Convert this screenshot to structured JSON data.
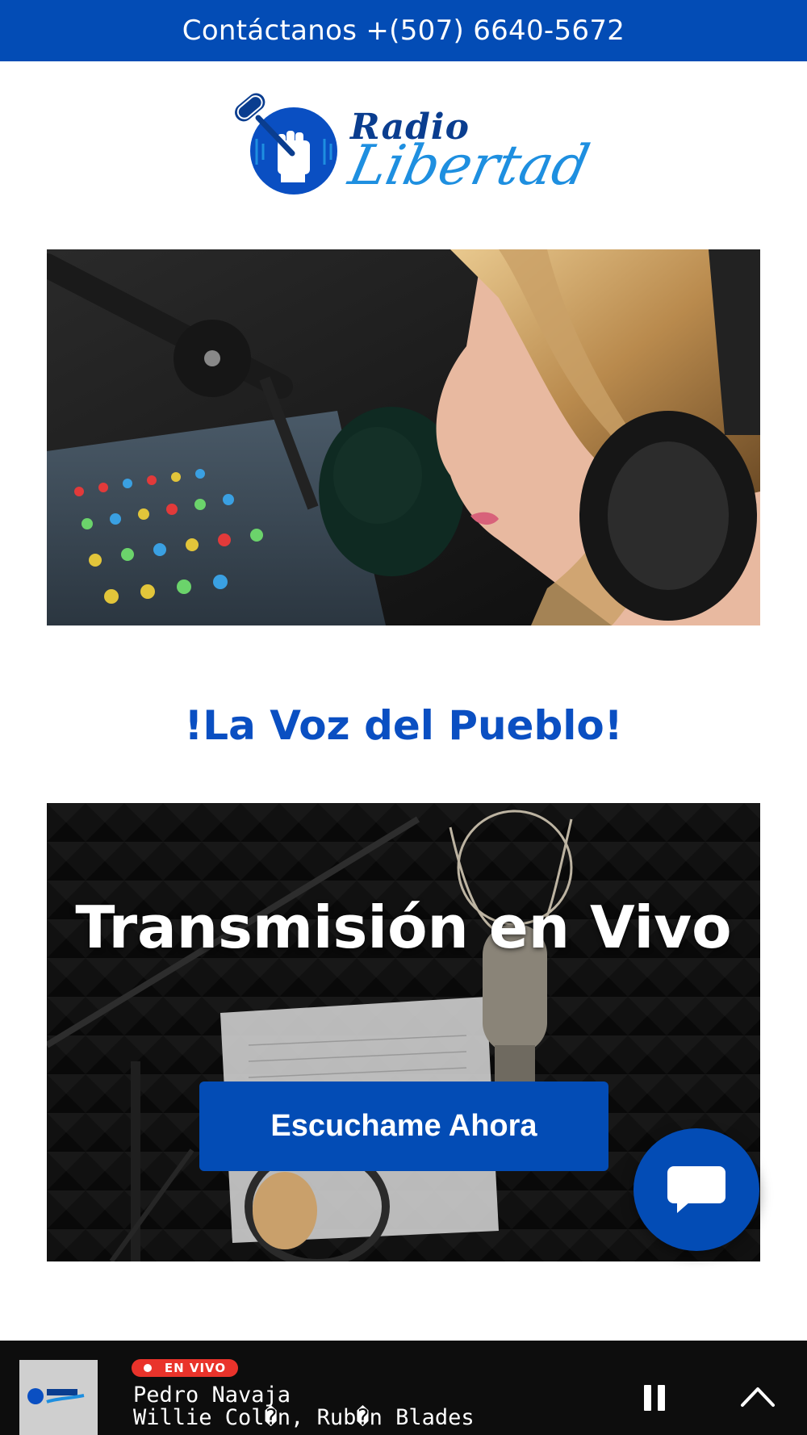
{
  "header": {
    "contact_text": "Contáctanos +(507) 6640-5672"
  },
  "logo": {
    "line1": "Radio",
    "line2": "Libertad"
  },
  "tagline": "!La Voz del Pueblo!",
  "live_section": {
    "title": "Transmisión en Vivo",
    "button_label": "Escuchame Ahora"
  },
  "player": {
    "badge": "EN VIVO",
    "track_title": "Pedro Navaja",
    "track_artist": "Willie Col�n, Rub�n Blades"
  },
  "colors": {
    "brand_blue": "#034cb5",
    "tagline_blue": "#0a4fc2",
    "live_red": "#e9332b"
  },
  "icons": {
    "chat": "chat-bubble-icon",
    "pause": "pause-icon",
    "expand": "chevron-up-icon",
    "logo_emblem": "microphone-fist-icon"
  }
}
